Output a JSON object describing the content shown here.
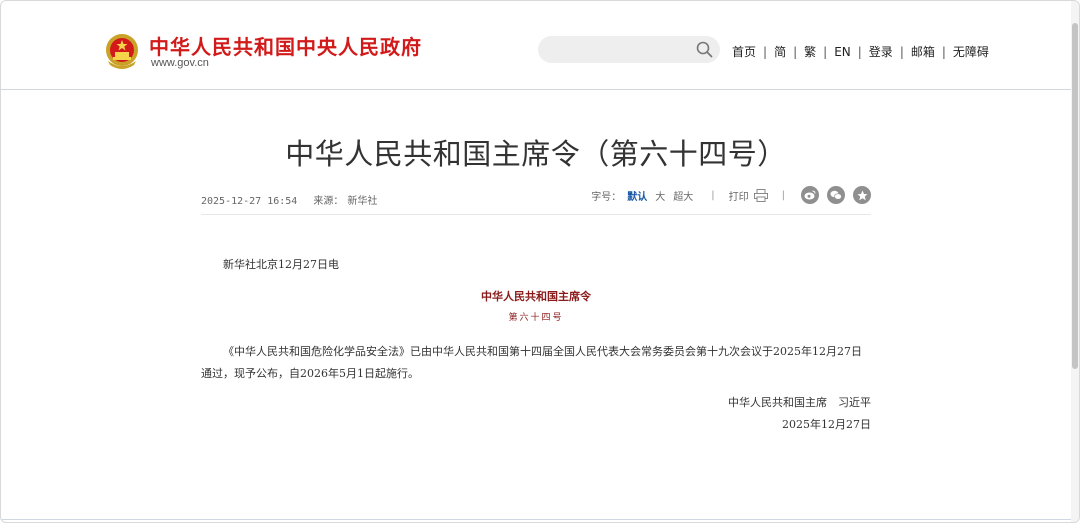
{
  "header": {
    "site_name": "中华人民共和国中央人民政府",
    "site_url": "www.gov.cn",
    "search_placeholder": "",
    "nav": [
      "首页",
      "简",
      "繁",
      "EN",
      "登录",
      "邮箱",
      "无障碍"
    ]
  },
  "article": {
    "title": "中华人民共和国主席令（第六十四号）",
    "date": "2025-12-27 16:54",
    "source_label": "来源：",
    "source": "新华社",
    "font_size_label": "字号：",
    "font_sizes": [
      "默认",
      "大",
      "超大"
    ],
    "active_font_size": "默认",
    "print_label": "打印",
    "share_icons": [
      "weibo-icon",
      "wechat-icon",
      "favorite-icon"
    ],
    "dateline": "新华社北京12月27日电",
    "order_title": "中华人民共和国主席令",
    "order_number": "第六十四号",
    "paragraph": "《中华人民共和国危险化学品安全法》已由中华人民共和国第十四届全国人民代表大会常务委员会第十九次会议于2025年12月27日通过，现予公布，自2026年5月1日起施行。",
    "signature": "中华人民共和国主席　习近平",
    "sign_date": "2025年12月27日"
  },
  "colors": {
    "brand_red": "#d21a1a",
    "order_red": "#8b1a1a",
    "active_blue": "#1a5aa6"
  }
}
